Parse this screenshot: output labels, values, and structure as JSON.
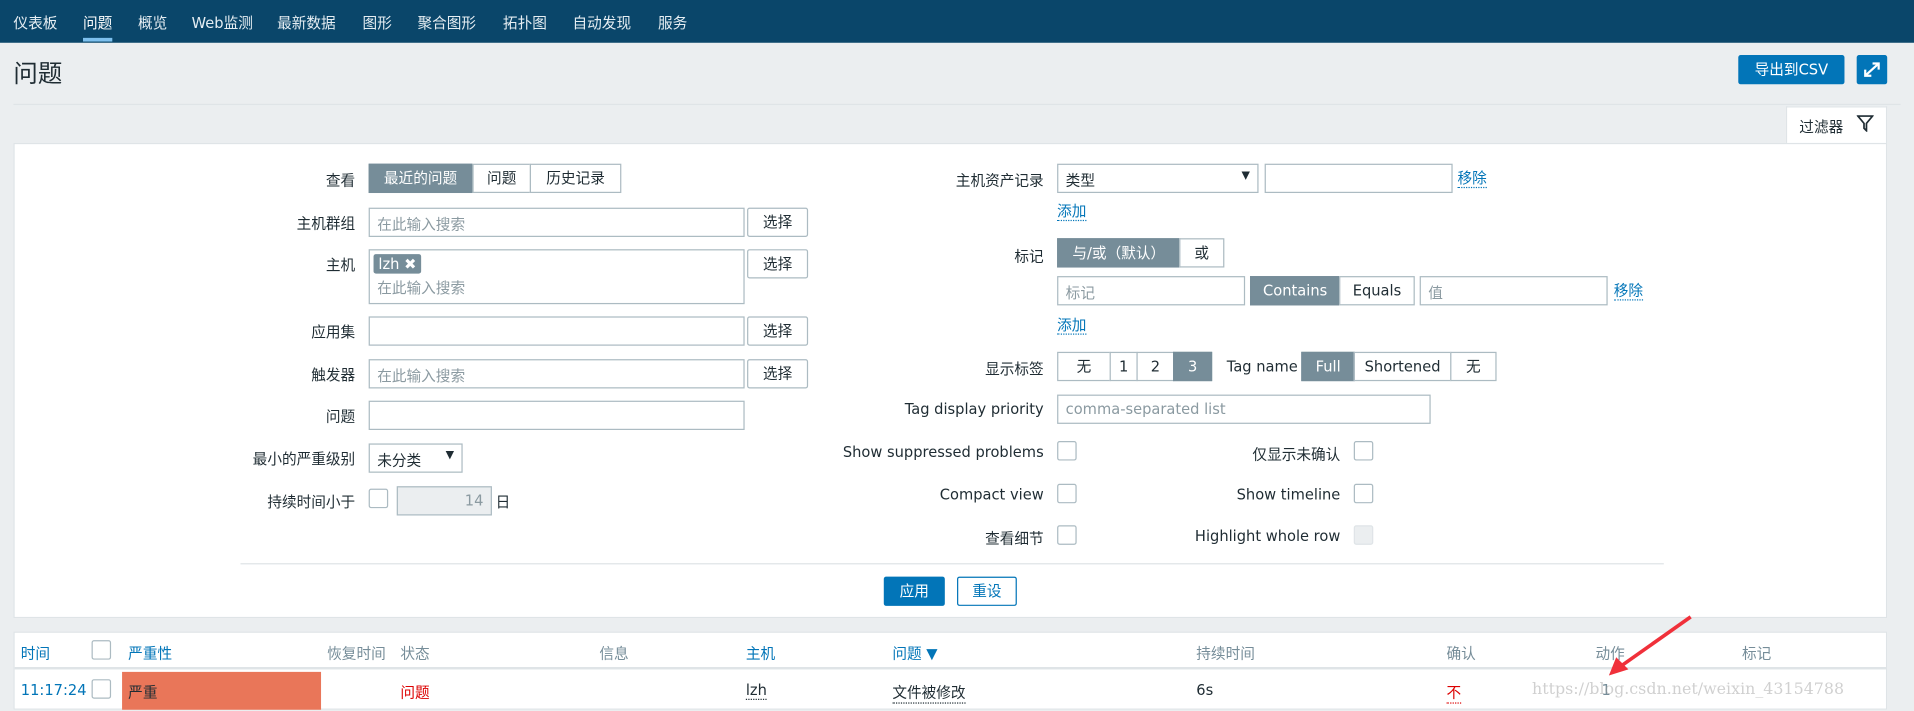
{
  "nav": {
    "items": [
      "仪表板",
      "问题",
      "概览",
      "Web监测",
      "最新数据",
      "图形",
      "聚合图形",
      "拓扑图",
      "自动发现",
      "服务"
    ],
    "active_index": 1
  },
  "page": {
    "title": "问题",
    "export_label": "导出到CSV",
    "fullscreen_icon": "expand-icon"
  },
  "filter": {
    "tab_label": "过滤器",
    "tab_icon": "funnel-icon",
    "view": {
      "label": "查看",
      "options": [
        "最近的问题",
        "问题",
        "历史记录"
      ],
      "selected": "最近的问题"
    },
    "host_groups": {
      "label": "主机群组",
      "placeholder": "在此输入搜索",
      "select": "选择"
    },
    "hosts": {
      "label": "主机",
      "tags": [
        "lzh"
      ],
      "placeholder": "在此输入搜索",
      "select": "选择"
    },
    "application": {
      "label": "应用集",
      "value": "",
      "select": "选择"
    },
    "triggers": {
      "label": "触发器",
      "placeholder": "在此输入搜索",
      "select": "选择"
    },
    "problem": {
      "label": "问题",
      "value": ""
    },
    "min_severity": {
      "label": "最小的严重级别",
      "value": "未分类"
    },
    "age": {
      "label": "持续时间小于",
      "checked": false,
      "value": "14",
      "unit": "日"
    },
    "inventory": {
      "label": "主机资产记录",
      "field": "类型",
      "value": "",
      "remove": "移除",
      "add": "添加"
    },
    "tags": {
      "label": "标记",
      "operators": [
        "与/或（默认）",
        "或"
      ],
      "selected_operator": "与/或（默认）",
      "tag_placeholder": "标记",
      "match_options": [
        "Contains",
        "Equals"
      ],
      "selected_match": "Contains",
      "value_placeholder": "值",
      "remove": "移除",
      "add": "添加"
    },
    "show_tags": {
      "label": "显示标签",
      "options": [
        "无",
        "1",
        "2",
        "3"
      ],
      "selected": "3"
    },
    "tag_name": {
      "label": "Tag name",
      "options": [
        "Full",
        "Shortened",
        "无"
      ],
      "selected": "Full"
    },
    "tag_priority": {
      "label": "Tag display priority",
      "placeholder": "comma-separated list"
    },
    "show_suppressed": {
      "label": "Show suppressed problems",
      "checked": false
    },
    "unack_only": {
      "label": "仅显示未确认",
      "checked": false
    },
    "compact_view": {
      "label": "Compact view",
      "checked": false
    },
    "show_timeline": {
      "label": "Show timeline",
      "checked": false
    },
    "details": {
      "label": "查看细节",
      "checked": false
    },
    "highlight_row": {
      "label": "Highlight whole row",
      "checked": false,
      "disabled": true
    },
    "apply": "应用",
    "reset": "重设"
  },
  "table": {
    "headers": [
      "时间",
      "严重性",
      "恢复时间",
      "状态",
      "信息",
      "主机",
      "问题 ▼",
      "持续时间",
      "确认",
      "动作",
      "标记"
    ],
    "rows": [
      {
        "time": "11:17:24",
        "severity": "严重",
        "recovery": "",
        "status": "问题",
        "info": "",
        "host": "lzh",
        "problem": "文件被修改",
        "duration": "6s",
        "ack": "不",
        "actions": "1",
        "tags": ""
      }
    ]
  },
  "colors": {
    "nav": "#0a466a",
    "accent": "#0275b8",
    "severity_high": "#e97659",
    "status_problem": "#dc0000",
    "segment_on": "#768d99"
  },
  "watermark": "https://blog.csdn.net/weixin_43154788"
}
